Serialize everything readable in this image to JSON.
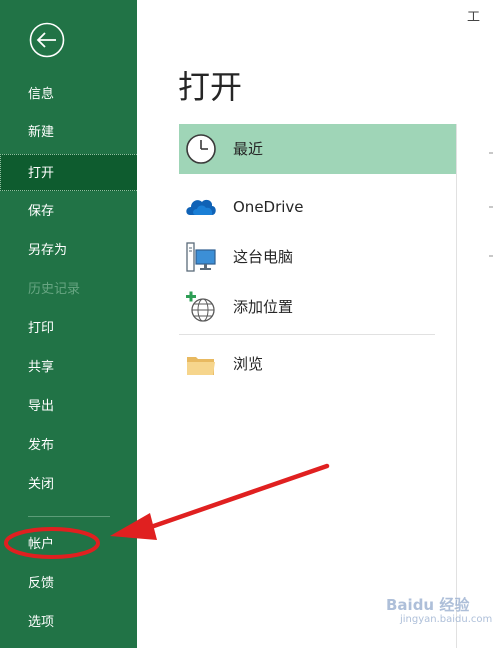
{
  "window": {
    "title_fragment": "工"
  },
  "sidebar": {
    "items": [
      {
        "label": "信息",
        "state": "normal"
      },
      {
        "label": "新建",
        "state": "normal"
      },
      {
        "label": "打开",
        "state": "selected"
      },
      {
        "label": "保存",
        "state": "normal"
      },
      {
        "label": "另存为",
        "state": "normal"
      },
      {
        "label": "历史记录",
        "state": "disabled"
      },
      {
        "label": "打印",
        "state": "normal"
      },
      {
        "label": "共享",
        "state": "normal"
      },
      {
        "label": "导出",
        "state": "normal"
      },
      {
        "label": "发布",
        "state": "normal"
      },
      {
        "label": "关闭",
        "state": "normal"
      },
      {
        "label": "帐户",
        "state": "normal"
      },
      {
        "label": "反馈",
        "state": "normal"
      },
      {
        "label": "选项",
        "state": "normal"
      }
    ]
  },
  "main": {
    "title": "打开",
    "locations": [
      {
        "label": "最近",
        "icon": "clock-icon",
        "selected": true
      },
      {
        "label": "OneDrive",
        "icon": "cloud-icon",
        "selected": false
      },
      {
        "label": "这台电脑",
        "icon": "computer-icon",
        "selected": false
      },
      {
        "label": "添加位置",
        "icon": "add-location-globe-icon",
        "selected": false
      },
      {
        "label": "浏览",
        "icon": "folder-icon",
        "selected": false
      }
    ]
  },
  "colors": {
    "sidebar_bg": "#217346",
    "sidebar_selected_bg": "#0e5c2f",
    "location_selected_bg": "#9fd5b7",
    "annotation_red": "#e02020"
  },
  "watermark": {
    "text": "Baidu 经验",
    "sub": "jingyan.baidu.com"
  }
}
